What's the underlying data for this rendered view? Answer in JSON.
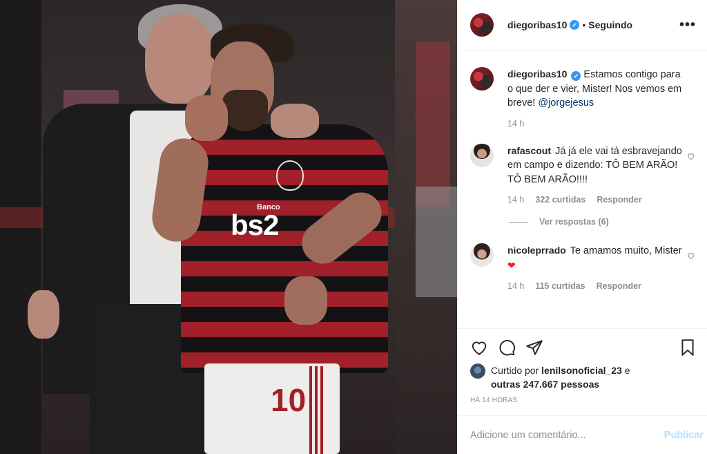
{
  "header": {
    "username": "diegoribas10",
    "verified_mark": "✔",
    "separator": "•",
    "follow_status": "Seguindo",
    "more_label": "•••"
  },
  "photo": {
    "jersey_sponsor_small": "Banco",
    "jersey_sponsor": "bs2",
    "shorts_number": "10"
  },
  "caption": {
    "username": "diegoribas10",
    "text": "Estamos contigo para o que der e vier, Mister! Nos vemos em breve!",
    "mention": "@jorgejesus",
    "time": "14 h"
  },
  "comments": [
    {
      "username": "rafascout",
      "text": "Já já ele vai tá esbravejando em campo e dizendo: TÔ BEM ARÃO! TÔ BEM ARÃO!!!!",
      "time": "14 h",
      "likes": "322 curtidas",
      "reply": "Responder",
      "view_replies": "Ver respostas (6)"
    },
    {
      "username": "nicoleprrado",
      "text": "Te amamos muito, Mister",
      "emoji": "❤",
      "time": "14 h",
      "likes": "115 curtidas",
      "reply": "Responder"
    }
  ],
  "likes": {
    "prefix": "Curtido por",
    "user": "lenilsonoficial_23",
    "conjunction": "e",
    "others": "outras 247.667 pessoas"
  },
  "post_time": "HÁ 14 HORAS",
  "add_comment": {
    "placeholder": "Adicione um comentário...",
    "publish": "Publicar"
  },
  "colors": {
    "verified": "#3897f0",
    "text": "#262626",
    "secondary": "#8e8e8e",
    "publish_disabled": "#b2dffc",
    "heart": "#ed1c24"
  }
}
